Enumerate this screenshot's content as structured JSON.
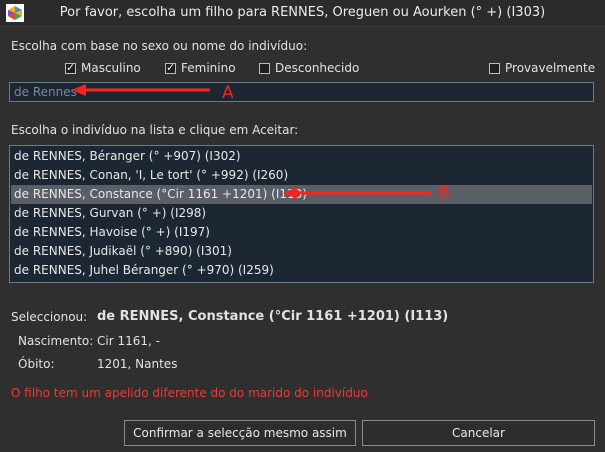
{
  "window": {
    "title": "Por favor, escolha um filho para RENNES, Oreguen ou Aourken (° +) (I303)"
  },
  "filter": {
    "label": "Escolha com base no sexo ou nome do indivíduo:",
    "options": [
      {
        "label": "Masculino",
        "checked": true
      },
      {
        "label": "Feminino",
        "checked": true
      },
      {
        "label": "Desconhecido",
        "checked": false
      },
      {
        "label": "Provavelmente",
        "checked": false
      }
    ],
    "search_value": "de Rennes"
  },
  "list": {
    "label": "Escolha o indivíduo na lista e clique em Aceitar:",
    "items": [
      "de RENNES, Béranger (° +907) (I302)",
      "de RENNES, Conan, 'I, Le tort' (° +992) (I260)",
      "de RENNES, Constance (°Cir 1161 +1201) (I113)",
      "de RENNES, Gurvan (° +) (I298)",
      "de RENNES, Havoise (° +) (I197)",
      "de RENNES, Judikaël (° +890) (I301)",
      "de RENNES, Juhel Béranger (° +970) (I259)"
    ],
    "selected_index": 2
  },
  "annotations": {
    "a": "A",
    "b": "B",
    "color": "#ff2020"
  },
  "details": {
    "selected_label": "Seleccionou:",
    "selected_value": "de RENNES, Constance (°Cir 1161 +1201) (I113)",
    "birth_label": "Nascimento:",
    "birth_value": "Cir 1161,  -",
    "death_label": "Óbito:",
    "death_value": "1201, Nantes"
  },
  "warning": "O filho tem um apelido diferente do do marido do indivíduo",
  "buttons": {
    "confirm": "Confirmar a selecção mesmo assim",
    "cancel": "Cancelar"
  }
}
